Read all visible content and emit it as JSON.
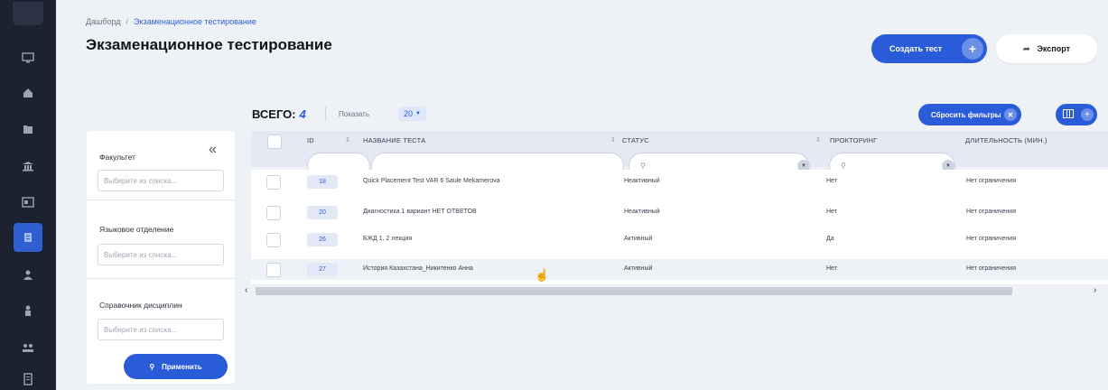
{
  "breadcrumb": {
    "home": "Дашборд",
    "separator": "/",
    "current": "Экзаменационное тестирование"
  },
  "title": "Экзаменационное тестирование",
  "actions": {
    "create": "Создать тест",
    "export": "Экспорт",
    "reset_filters": "Сбросить фильтры"
  },
  "summary": {
    "total_label": "ВСЕГО:",
    "total_count": "4",
    "show_label": "Показать",
    "show_value": "20"
  },
  "filters": {
    "faculty": {
      "label": "Факультет",
      "placeholder": "Выберите из списка..."
    },
    "language_dept": {
      "label": "Языковое отделение",
      "placeholder": "Выберите из списка..."
    },
    "disciplines": {
      "label": "Справочник дисциплин",
      "placeholder": "Выберите из списка..."
    },
    "apply": "Применить"
  },
  "table": {
    "columns": {
      "id": "ID",
      "name": "НАЗВАНИЕ ТЕСТА",
      "status": "СТАТУС",
      "proctoring": "ПРОКТОРИНГ",
      "duration": "ДЛИТЕЛЬНОСТЬ (МИН.)"
    },
    "rows": [
      {
        "id": "18",
        "name": "Quick Placement Test VAR 6 Saule Mekamerova",
        "status": "Неактивный",
        "proctoring": "Нет",
        "duration": "Нет ограничения"
      },
      {
        "id": "20",
        "name": "Диагностика 1 вариант НЕТ ОТВЕТОВ",
        "status": "Неактивный",
        "proctoring": "Нет",
        "duration": "Нет ограничения"
      },
      {
        "id": "26",
        "name": "БЖД 1, 2 лекция",
        "status": "Активный",
        "proctoring": "Да",
        "duration": "Нет ограничения"
      },
      {
        "id": "27",
        "name": "История Казахстана_Никитенко Анна",
        "status": "Активный",
        "proctoring": "Нет",
        "duration": "Нет ограничения"
      }
    ]
  },
  "colors": {
    "accent": "#2a5cd9",
    "nav_bg": "#1c2230",
    "page_bg": "#eef1f6"
  }
}
